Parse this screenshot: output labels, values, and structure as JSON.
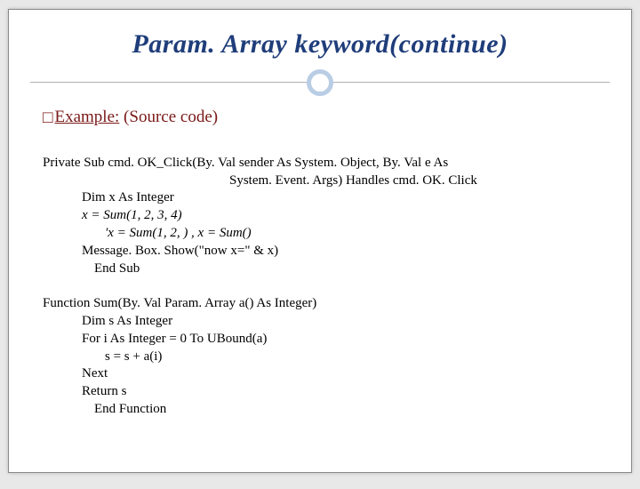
{
  "title": "Param. Array keyword(continue)",
  "section": {
    "square": "□",
    "exampleLabel": "Example:",
    "sourceCode": " (Source code)"
  },
  "code": {
    "l1": "Private Sub cmd. OK_Click(By. Val sender As System. Object, By. Val e As",
    "l2": "System. Event. Args) Handles cmd. OK. Click",
    "l3": "Dim x As Integer",
    "l4": "x = Sum(1, 2, 3, 4)",
    "l5": "'x = Sum(1, 2, ) , x = Sum()",
    "l6": "Message. Box. Show(\"now x=\" & x)",
    "l7": "End Sub",
    "l8": "Function Sum(By. Val Param. Array a() As Integer)",
    "l9": "Dim s As Integer",
    "l10": "For i As Integer = 0 To UBound(a)",
    "l11": "s = s + a(i)",
    "l12": "Next",
    "l13": "Return s",
    "l14": "End Function"
  }
}
